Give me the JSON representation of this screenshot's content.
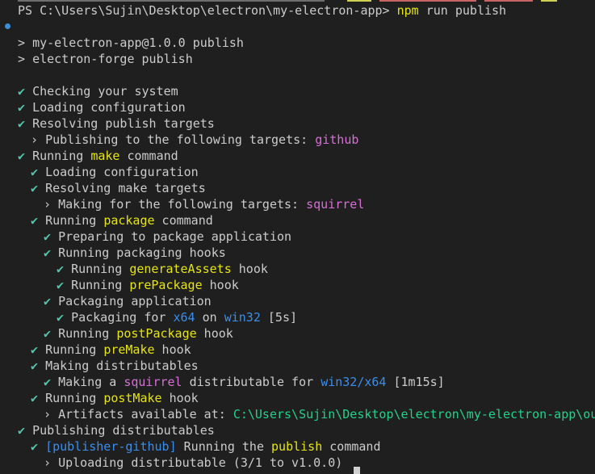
{
  "terminal": {
    "prompt": "PS C:\\Users\\Sujin\\Desktop\\electron\\my-electron-app>",
    "command": "npm",
    "command_args": "run publish",
    "check_glyph": "✔",
    "caret_glyph": ">",
    "arrow_glyph": "›",
    "colors": {
      "background": "#1f1f1f",
      "foreground": "#cccccc",
      "check": "#4ec9b0",
      "yellow": "#e5e510",
      "magenta": "#d670d6",
      "blue": "#3b8eea",
      "green": "#23d18b",
      "prompt_dot": "#3c8fd6"
    },
    "script_lines": [
      "my-electron-app@1.0.0 publish",
      "electron-forge publish"
    ],
    "steps": [
      {
        "indent": 0,
        "marker": "check",
        "parts": [
          {
            "t": "Checking your system"
          }
        ]
      },
      {
        "indent": 0,
        "marker": "check",
        "parts": [
          {
            "t": "Loading configuration"
          }
        ]
      },
      {
        "indent": 0,
        "marker": "check",
        "parts": [
          {
            "t": "Resolving publish targets"
          }
        ]
      },
      {
        "indent": 1,
        "marker": "arrow",
        "parts": [
          {
            "t": "Publishing to the following targets: "
          },
          {
            "t": "github",
            "c": "m"
          }
        ]
      },
      {
        "indent": 0,
        "marker": "check",
        "parts": [
          {
            "t": "Running "
          },
          {
            "t": "make",
            "c": "y"
          },
          {
            "t": " command"
          }
        ]
      },
      {
        "indent": 1,
        "marker": "check",
        "parts": [
          {
            "t": "Loading configuration"
          }
        ]
      },
      {
        "indent": 1,
        "marker": "check",
        "parts": [
          {
            "t": "Resolving make targets"
          }
        ]
      },
      {
        "indent": 2,
        "marker": "arrow",
        "parts": [
          {
            "t": "Making for the following targets: "
          },
          {
            "t": "squirrel",
            "c": "m"
          }
        ]
      },
      {
        "indent": 1,
        "marker": "check",
        "parts": [
          {
            "t": "Running "
          },
          {
            "t": "package",
            "c": "y"
          },
          {
            "t": " command"
          }
        ]
      },
      {
        "indent": 2,
        "marker": "check",
        "parts": [
          {
            "t": "Preparing to package application"
          }
        ]
      },
      {
        "indent": 2,
        "marker": "check",
        "parts": [
          {
            "t": "Running packaging hooks"
          }
        ]
      },
      {
        "indent": 3,
        "marker": "check",
        "parts": [
          {
            "t": "Running "
          },
          {
            "t": "generateAssets",
            "c": "y"
          },
          {
            "t": " hook"
          }
        ]
      },
      {
        "indent": 3,
        "marker": "check",
        "parts": [
          {
            "t": "Running "
          },
          {
            "t": "prePackage",
            "c": "y"
          },
          {
            "t": " hook"
          }
        ]
      },
      {
        "indent": 2,
        "marker": "check",
        "parts": [
          {
            "t": "Packaging application"
          }
        ]
      },
      {
        "indent": 3,
        "marker": "check",
        "parts": [
          {
            "t": "Packaging for "
          },
          {
            "t": "x64",
            "c": "b"
          },
          {
            "t": " on "
          },
          {
            "t": "win32",
            "c": "b"
          },
          {
            "t": " [5s]"
          }
        ]
      },
      {
        "indent": 2,
        "marker": "check",
        "parts": [
          {
            "t": "Running "
          },
          {
            "t": "postPackage",
            "c": "y"
          },
          {
            "t": " hook"
          }
        ]
      },
      {
        "indent": 1,
        "marker": "check",
        "parts": [
          {
            "t": "Running "
          },
          {
            "t": "preMake",
            "c": "y"
          },
          {
            "t": " hook"
          }
        ]
      },
      {
        "indent": 1,
        "marker": "check",
        "parts": [
          {
            "t": "Making distributables"
          }
        ]
      },
      {
        "indent": 2,
        "marker": "check",
        "parts": [
          {
            "t": "Making a "
          },
          {
            "t": "squirrel",
            "c": "m"
          },
          {
            "t": " distributable for "
          },
          {
            "t": "win32/x64",
            "c": "b"
          },
          {
            "t": " [1m15s]"
          }
        ]
      },
      {
        "indent": 1,
        "marker": "check",
        "parts": [
          {
            "t": "Running "
          },
          {
            "t": "postMake",
            "c": "y"
          },
          {
            "t": " hook"
          }
        ]
      },
      {
        "indent": 2,
        "marker": "arrow",
        "parts": [
          {
            "t": "Artifacts available at: "
          },
          {
            "t": "C:\\Users\\Sujin\\Desktop\\electron\\my-electron-app\\out\\make",
            "c": "g"
          }
        ]
      },
      {
        "indent": 0,
        "marker": "check",
        "parts": [
          {
            "t": "Publishing distributables"
          }
        ]
      },
      {
        "indent": 1,
        "marker": "check",
        "parts": [
          {
            "t": "[publisher-github]",
            "c": "b"
          },
          {
            "t": " Running the "
          },
          {
            "t": "publish",
            "c": "y"
          },
          {
            "t": " command"
          }
        ]
      },
      {
        "indent": 2,
        "marker": "arrow",
        "parts": [
          {
            "t": "Uploading distributable (3/1 to v1.0.0)"
          }
        ]
      }
    ]
  }
}
